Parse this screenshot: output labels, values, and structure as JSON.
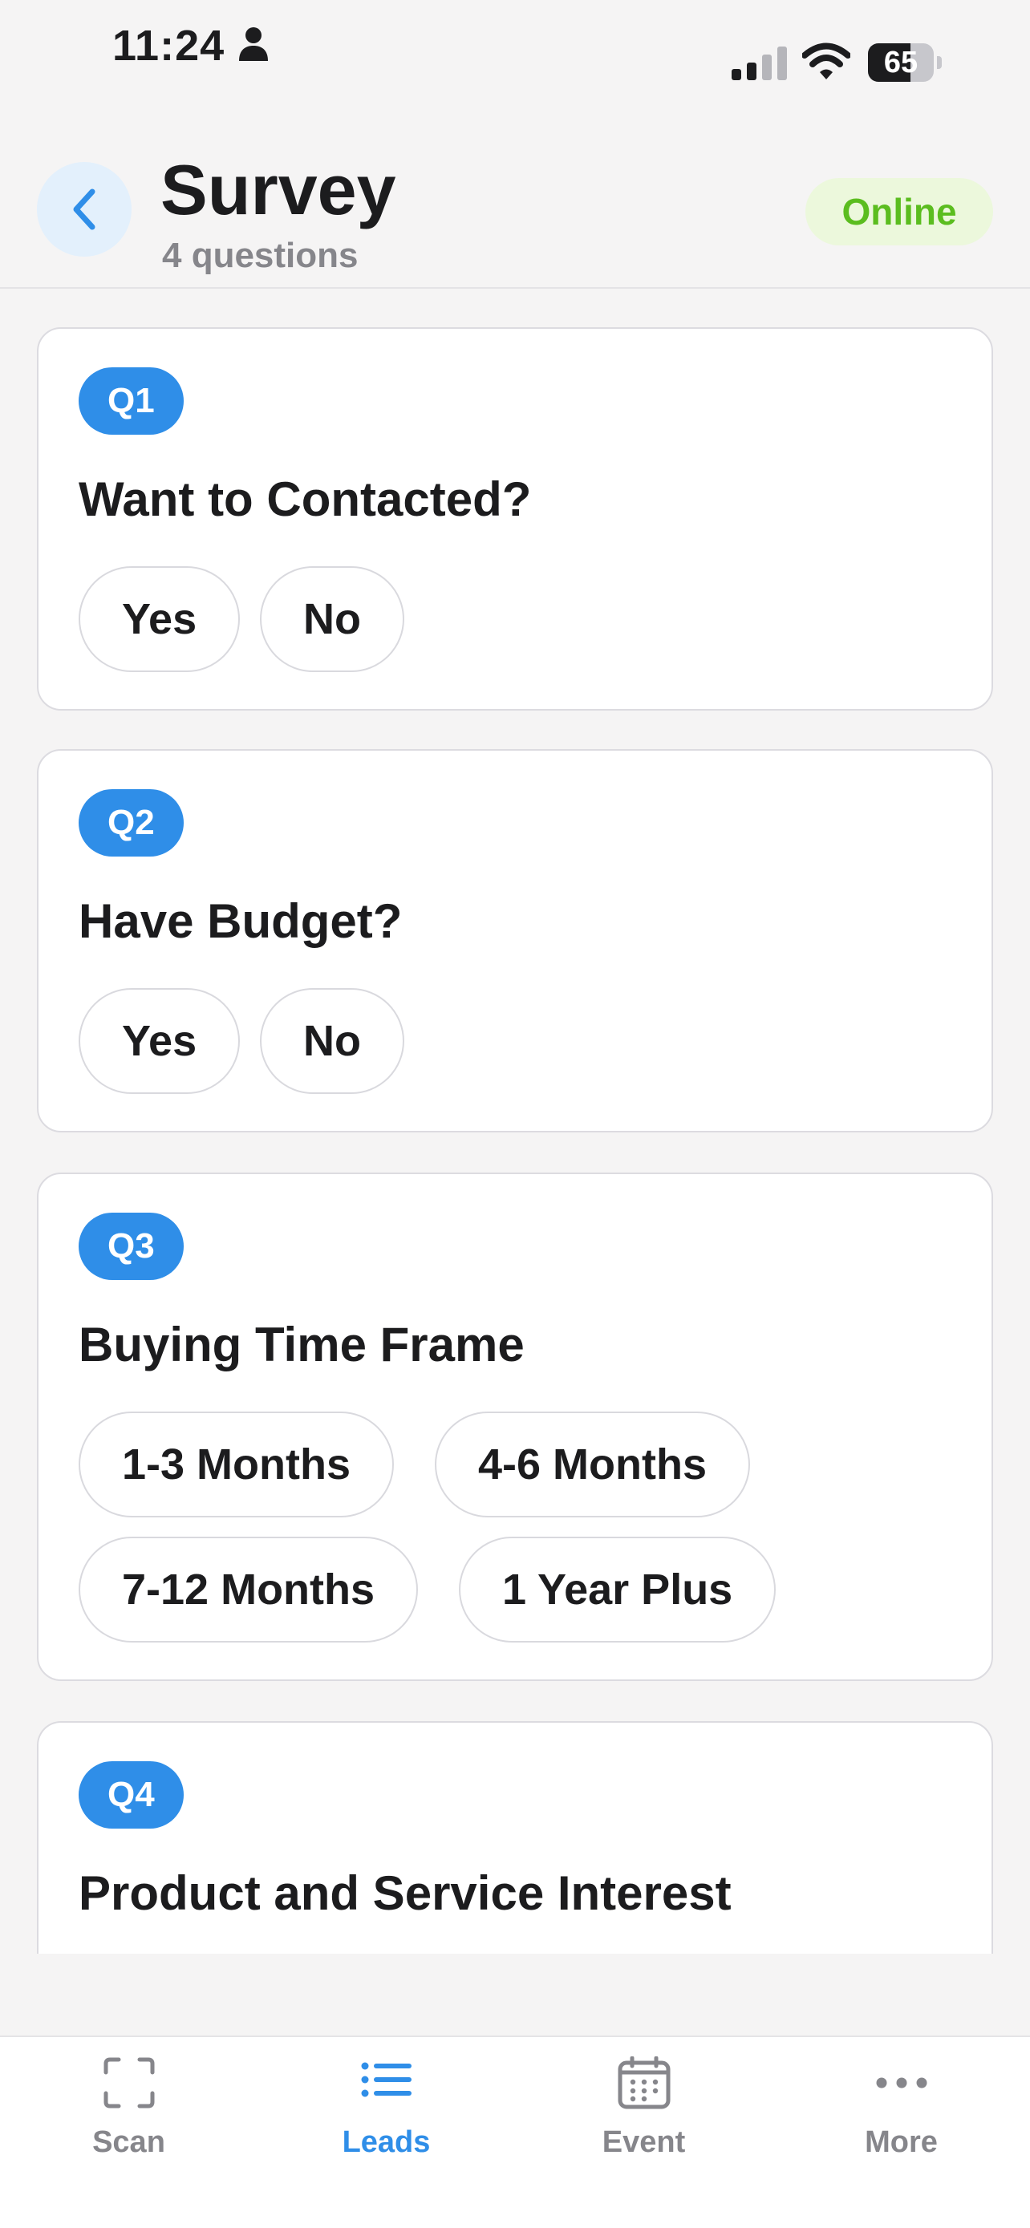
{
  "status_bar": {
    "time": "11:24",
    "battery_percent": "65",
    "battery_level": 0.65
  },
  "header": {
    "title": "Survey",
    "subtitle": "4 questions",
    "connection_status": "Online"
  },
  "colors": {
    "accent": "#2f8ee8",
    "online_text": "#5bbd1f",
    "online_bg": "#ecf8dc",
    "back_button_bg": "#e3f0fc"
  },
  "questions": [
    {
      "badge": "Q1",
      "title": "Want to Contacted?",
      "options": [
        "Yes",
        "No"
      ]
    },
    {
      "badge": "Q2",
      "title": "Have Budget?",
      "options": [
        "Yes",
        "No"
      ]
    },
    {
      "badge": "Q3",
      "title": "Buying Time Frame",
      "options": [
        "1-3 Months",
        "4-6 Months",
        "7-12 Months",
        "1 Year Plus"
      ]
    },
    {
      "badge": "Q4",
      "title": "Product and Service Interest",
      "options": []
    }
  ],
  "bottom_nav": {
    "items": [
      {
        "label": "Scan",
        "icon": "scan-icon",
        "active": false
      },
      {
        "label": "Leads",
        "icon": "list-icon",
        "active": true
      },
      {
        "label": "Event",
        "icon": "calendar-icon",
        "active": false
      },
      {
        "label": "More",
        "icon": "more-icon",
        "active": false
      }
    ]
  }
}
